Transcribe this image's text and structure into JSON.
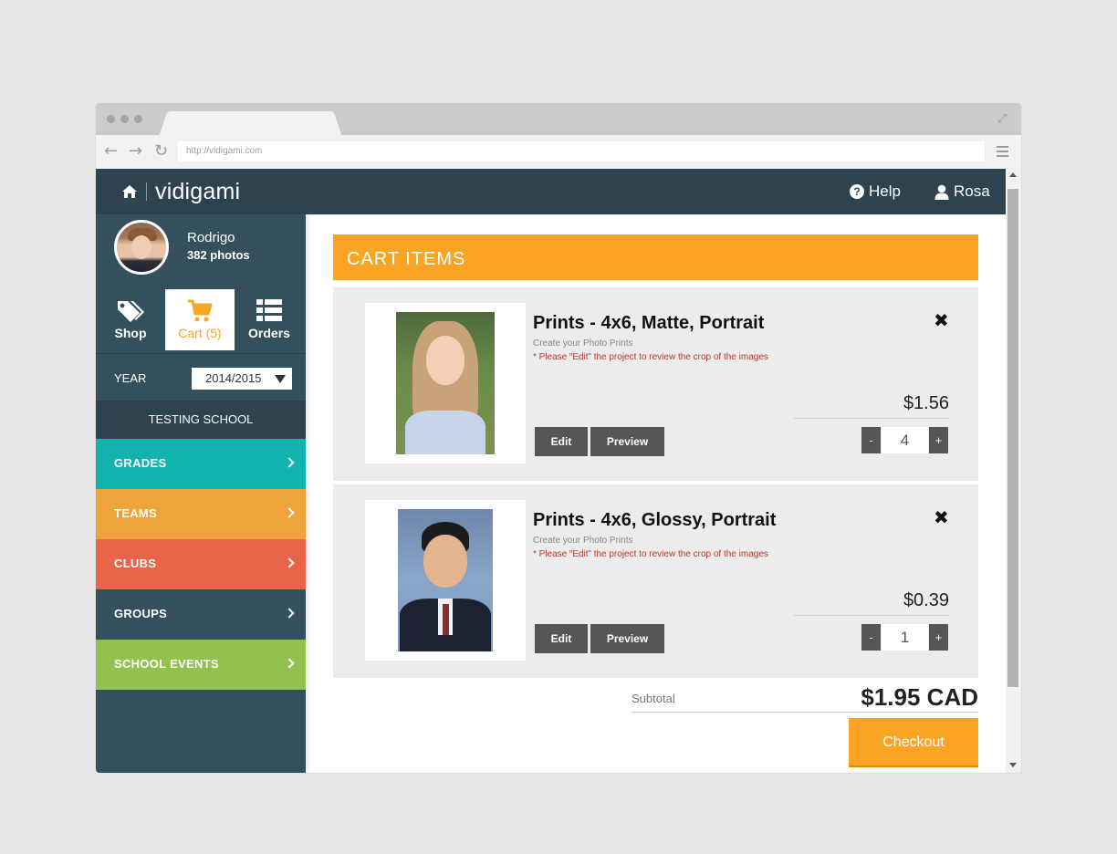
{
  "browser": {
    "url": "http://vidigami.com"
  },
  "header": {
    "logo_text": "vidigami",
    "help_label": "Help",
    "user_label": "Rosa"
  },
  "profile": {
    "name": "Rodrigo",
    "photo_count": "382 photos"
  },
  "tabs": [
    {
      "label": "Shop",
      "icon": "tags-icon"
    },
    {
      "label": "Cart (5)",
      "icon": "cart-icon"
    },
    {
      "label": "Orders",
      "icon": "list-icon"
    }
  ],
  "year": {
    "label": "YEAR",
    "selected": "2014/2015"
  },
  "school": "TESTING SCHOOL",
  "categories": [
    {
      "label": "GRADES",
      "color": "#12b3ad"
    },
    {
      "label": "TEAMS",
      "color": "#efa33b"
    },
    {
      "label": "CLUBS",
      "color": "#e8654b"
    },
    {
      "label": "GROUPS",
      "color": "#34505d"
    },
    {
      "label": "SCHOOL EVENTS",
      "color": "#92c150"
    }
  ],
  "cart": {
    "title": "CART ITEMS",
    "items": [
      {
        "title": "Prints - 4x6, Matte, Portrait",
        "subtitle": "Create your Photo Prints",
        "note": "* Please “Edit” the project to review the crop of the images",
        "price": "$1.56",
        "quantity": "4",
        "edit_label": "Edit",
        "preview_label": "Preview"
      },
      {
        "title": "Prints - 4x6, Glossy, Portrait",
        "subtitle": "Create your Photo Prints",
        "note": "* Please “Edit” the project to review the crop of the images",
        "price": "$0.39",
        "quantity": "1",
        "edit_label": "Edit",
        "preview_label": "Preview"
      }
    ],
    "qty_minus": "-",
    "qty_plus": "+",
    "subtotal_label": "Subtotal",
    "subtotal_value": "$1.95 CAD",
    "checkout_label": "Checkout"
  },
  "colors": {
    "accent": "#f9a425",
    "nav": "#2d4450",
    "sidebar": "#34505d"
  }
}
